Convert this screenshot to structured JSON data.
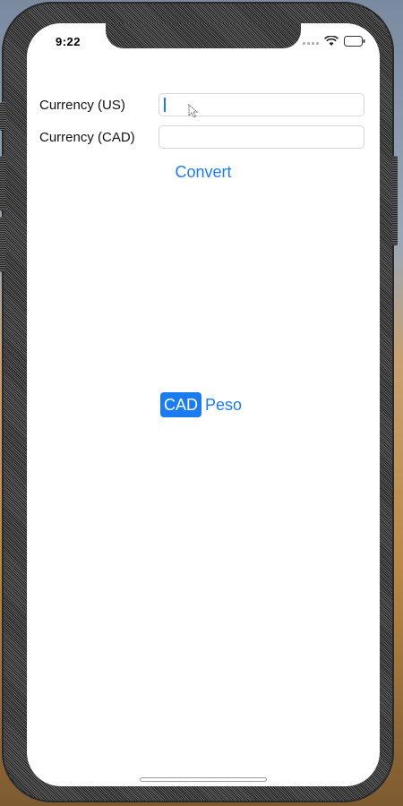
{
  "status_bar": {
    "time": "9:22"
  },
  "form": {
    "us_label": "Currency (US)",
    "us_value": "",
    "cad_label": "Currency (CAD)",
    "cad_value": ""
  },
  "convert_label": "Convert",
  "segmented_control": {
    "options": [
      "CAD",
      "Peso"
    ],
    "selected": "CAD"
  },
  "colors": {
    "accent": "#1a7cf0",
    "field_border": "#d6d6d6"
  },
  "icons": {
    "wifi": "wifi-icon",
    "battery": "battery-icon",
    "signal": "signal-icon",
    "cursor": "mouse-pointer-icon"
  }
}
